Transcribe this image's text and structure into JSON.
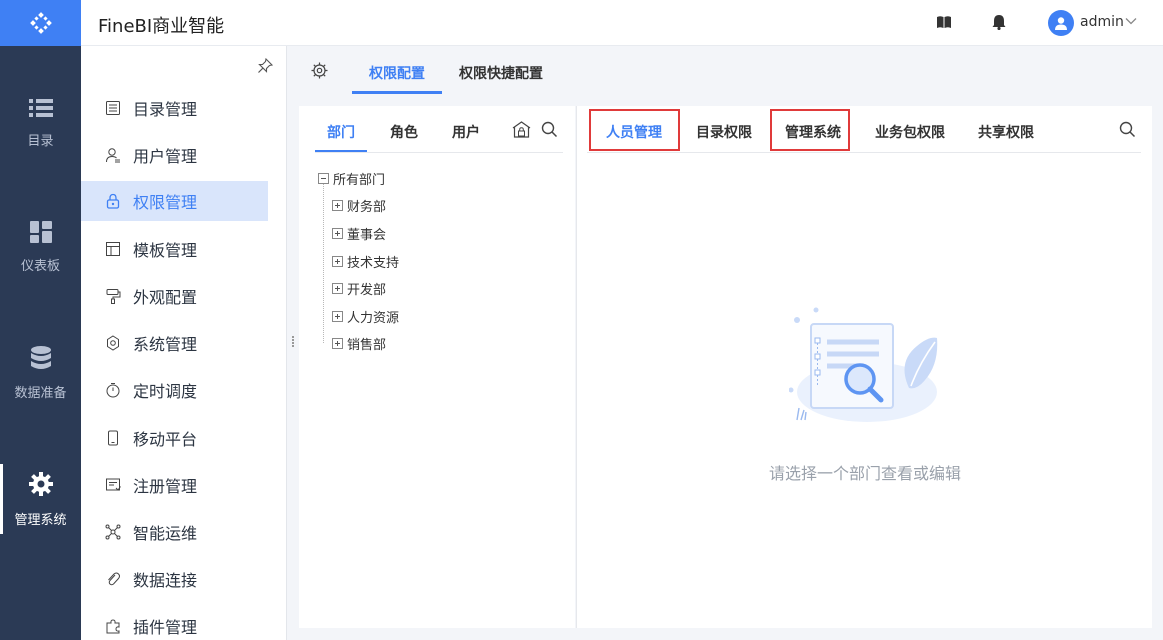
{
  "rail": {
    "items": [
      {
        "label": "目录",
        "icon": "catalog-list-icon"
      },
      {
        "label": "仪表板",
        "icon": "dashboard-grid-icon"
      },
      {
        "label": "数据准备",
        "icon": "database-icon"
      },
      {
        "label": "管理系统",
        "icon": "gear-icon",
        "active": true
      }
    ]
  },
  "header": {
    "title": "FineBI商业智能",
    "user": "admin"
  },
  "menu": {
    "items": [
      {
        "label": "目录管理",
        "icon": "catalog-manage-icon"
      },
      {
        "label": "用户管理",
        "icon": "user-manage-icon"
      },
      {
        "label": "权限管理",
        "icon": "lock-icon",
        "active": true
      },
      {
        "label": "模板管理",
        "icon": "template-icon"
      },
      {
        "label": "外观配置",
        "icon": "paint-roller-icon"
      },
      {
        "label": "系统管理",
        "icon": "settings-icon"
      },
      {
        "label": "定时调度",
        "icon": "timer-icon"
      },
      {
        "label": "移动平台",
        "icon": "mobile-icon"
      },
      {
        "label": "注册管理",
        "icon": "register-icon"
      },
      {
        "label": "智能运维",
        "icon": "ops-network-icon"
      },
      {
        "label": "数据连接",
        "icon": "link-icon"
      },
      {
        "label": "插件管理",
        "icon": "plugin-icon"
      }
    ]
  },
  "main_tabs": [
    {
      "label": "权限配置",
      "active": true
    },
    {
      "label": "权限快捷配置"
    }
  ],
  "left_tabs": [
    {
      "label": "部门",
      "active": true
    },
    {
      "label": "角色"
    },
    {
      "label": "用户"
    }
  ],
  "tree": {
    "root": "所有部门",
    "children": [
      "财务部",
      "董事会",
      "技术支持",
      "开发部",
      "人力资源",
      "销售部"
    ]
  },
  "right_tabs": [
    {
      "label": "人员管理",
      "active": true,
      "highlighted": true
    },
    {
      "label": "目录权限"
    },
    {
      "label": "管理系统",
      "highlighted": true
    },
    {
      "label": "业务包权限"
    },
    {
      "label": "共享权限"
    }
  ],
  "empty_state": {
    "message": "请选择一个部门查看或编辑",
    "icon": "empty-search-illustration"
  },
  "colors": {
    "accent": "#3f80f4",
    "rail_bg": "#2b3a55",
    "highlight_box": "#e03a3a",
    "active_menu_bg": "#d9e5fb"
  }
}
